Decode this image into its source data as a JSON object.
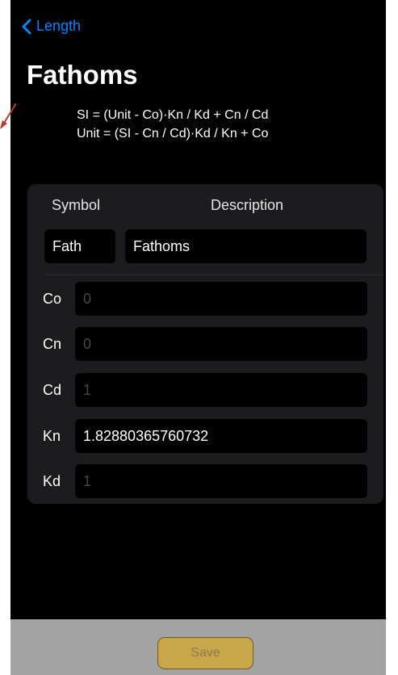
{
  "nav": {
    "back_label": "Length"
  },
  "title": "Fathoms",
  "formulas": [
    "SI = (Unit - Co)·Kn / Kd + Cn / Cd",
    "Unit = (SI - Cn / Cd)·Kd / Kn + Co"
  ],
  "table": {
    "headers": {
      "symbol": "Symbol",
      "description": "Description"
    },
    "symbol_value": "Fath",
    "description_value": "Fathoms"
  },
  "coefficients": [
    {
      "label": "Co",
      "value": "",
      "placeholder": "0"
    },
    {
      "label": "Cn",
      "value": "",
      "placeholder": "0"
    },
    {
      "label": "Cd",
      "value": "",
      "placeholder": "1"
    },
    {
      "label": "Kn",
      "value": "1.82880365760732",
      "placeholder": ""
    },
    {
      "label": "Kd",
      "value": "",
      "placeholder": "1"
    }
  ],
  "footer": {
    "save_label": "Save"
  },
  "colors": {
    "accent": "#0a84ff",
    "background": "#000000",
    "card": "#1c1c1e",
    "save_button": "#c9a64a",
    "footer_bar": "#a3a3a3",
    "annotation_arrow": "#c0392b"
  }
}
